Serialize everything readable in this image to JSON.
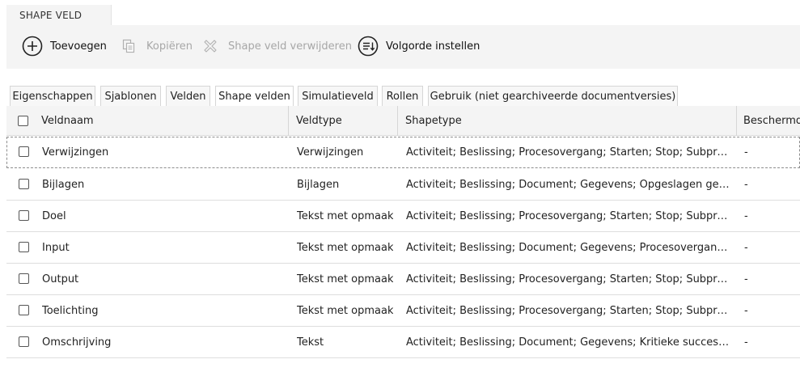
{
  "header": {
    "tab_label": "SHAPE VELD"
  },
  "toolbar": [
    {
      "label": "Toevoegen",
      "icon": "plus-circle-icon",
      "enabled": true
    },
    {
      "label": "Kopiëren",
      "icon": "copy-icon",
      "enabled": false
    },
    {
      "label": "Shape veld verwijderen",
      "icon": "delete-x-icon",
      "enabled": false
    },
    {
      "label": "Volgorde instellen",
      "icon": "sort-order-icon",
      "enabled": true
    }
  ],
  "tabs": [
    {
      "label": "Eigenschappen",
      "active": false
    },
    {
      "label": "Sjablonen",
      "active": false
    },
    {
      "label": "Velden",
      "active": false
    },
    {
      "label": "Shape velden",
      "active": true
    },
    {
      "label": "Simulatieveld",
      "active": false
    },
    {
      "label": "Rollen",
      "active": false
    },
    {
      "label": "Gebruik (niet gearchiveerde documentversies)",
      "active": false
    }
  ],
  "grid": {
    "columns": [
      "Veldnaam",
      "Veldtype",
      "Shapetype",
      "Beschermd"
    ],
    "rows": [
      {
        "veldnaam": "Verwijzingen",
        "veldtype": "Verwijzingen",
        "shapetype": "Activiteit; Beslissing; Procesovergang; Starten; Stop; Subproc...",
        "beschermd": "-"
      },
      {
        "veldnaam": "Bijlagen",
        "veldtype": "Bijlagen",
        "shapetype": "Activiteit; Beslissing; Document; Gegevens; Opgeslagen gege...",
        "beschermd": "-"
      },
      {
        "veldnaam": "Doel",
        "veldtype": "Tekst met opmaak",
        "shapetype": "Activiteit; Beslissing; Procesovergang; Starten; Stop; Subproc...",
        "beschermd": "-"
      },
      {
        "veldnaam": "Input",
        "veldtype": "Tekst met opmaak",
        "shapetype": "Activiteit; Beslissing; Document; Gegevens; Procesovergang; ...",
        "beschermd": "-"
      },
      {
        "veldnaam": "Output",
        "veldtype": "Tekst met opmaak",
        "shapetype": "Activiteit; Beslissing; Procesovergang; Starten; Stop; Subproc...",
        "beschermd": "-"
      },
      {
        "veldnaam": "Toelichting",
        "veldtype": "Tekst met opmaak",
        "shapetype": "Activiteit; Beslissing; Procesovergang; Starten; Stop; Subproc...",
        "beschermd": "-"
      },
      {
        "veldnaam": "Omschrijving",
        "veldtype": "Tekst",
        "shapetype": "Activiteit; Beslissing; Document; Gegevens; Kritieke succesfa...",
        "beschermd": "-"
      }
    ]
  },
  "colors": {
    "panel_bg": "#f4f4f4",
    "disabled_text": "#a7a7a7",
    "border": "#dcdcdc"
  }
}
